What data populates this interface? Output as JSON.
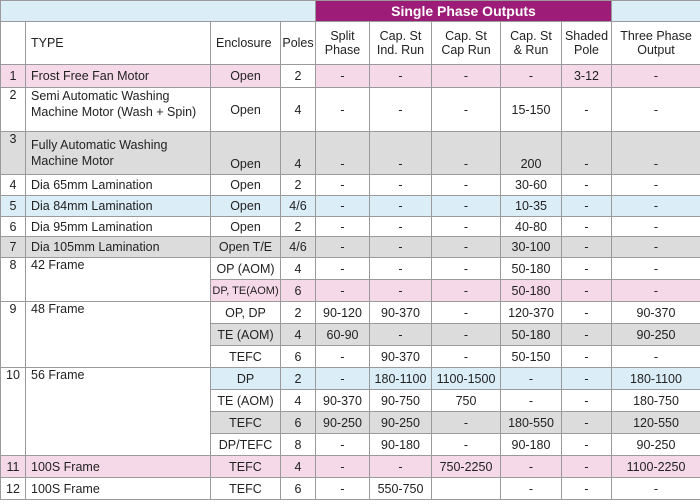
{
  "banner": "Single Phase Outputs",
  "headers": {
    "type": "TYPE",
    "enclosure": "Enclosure",
    "poles": "Poles",
    "split_phase": [
      "Split",
      "Phase"
    ],
    "cap_st_ind": [
      "Cap. St",
      "Ind. Run"
    ],
    "cap_st_cap": [
      "Cap. St",
      "Cap Run"
    ],
    "cap_st_run": [
      "Cap. St",
      "& Run"
    ],
    "shaded": [
      "Shaded",
      "Pole"
    ],
    "three_phase": [
      "Three Phase",
      "Output"
    ]
  },
  "rows": [
    {
      "no": "1",
      "type": "Frost Free Fan Motor",
      "enc": "Open",
      "poles": "2",
      "split": "-",
      "ind": "-",
      "cap": "-",
      "run": "-",
      "shaded": "3-12",
      "three": "-"
    },
    {
      "no": "2",
      "type": "Semi Automatic Washing",
      "type2": "Machine Motor (Wash + Spin)",
      "enc": "Open",
      "poles": "4",
      "split": "-",
      "ind": "-",
      "cap": "-",
      "run": "15-150",
      "shaded": "-",
      "three": "-"
    },
    {
      "no": "3",
      "type": "Fully Automatic Washing",
      "type2": "Machine Motor",
      "enc": "Open",
      "poles": "4",
      "split": "-",
      "ind": "-",
      "cap": "-",
      "run": "200",
      "shaded": "-",
      "three": "-"
    },
    {
      "no": "4",
      "type": "Dia 65mm Lamination",
      "enc": "Open",
      "poles": "2",
      "split": "-",
      "ind": "-",
      "cap": "-",
      "run": "30-60",
      "shaded": "-",
      "three": "-"
    },
    {
      "no": "5",
      "type": "Dia 84mm Lamination",
      "enc": "Open",
      "poles": "4/6",
      "split": "-",
      "ind": "-",
      "cap": "-",
      "run": "10-35",
      "shaded": "-",
      "three": "-"
    },
    {
      "no": "6",
      "type": "Dia 95mm Lamination",
      "enc": "Open",
      "poles": "2",
      "split": "-",
      "ind": "-",
      "cap": "-",
      "run": "40-80",
      "shaded": "-",
      "three": "-"
    },
    {
      "no": "7",
      "type": "Dia 105mm Lamination",
      "enc": "Open T/E",
      "poles": "4/6",
      "split": "-",
      "ind": "-",
      "cap": "-",
      "run": "30-100",
      "shaded": "-",
      "three": "-"
    },
    {
      "no": "8",
      "type": "42 Frame",
      "sub": [
        {
          "enc": "OP (AOM)",
          "poles": "4",
          "split": "-",
          "ind": "-",
          "cap": "-",
          "run": "50-180",
          "shaded": "-",
          "three": "-"
        },
        {
          "enc": "DP, TE(AOM)",
          "poles": "6",
          "split": "-",
          "ind": "-",
          "cap": "-",
          "run": "50-180",
          "shaded": "-",
          "three": "-"
        }
      ]
    },
    {
      "no": "9",
      "type": "48 Frame",
      "sub": [
        {
          "enc": "OP, DP",
          "poles": "2",
          "split": "90-120",
          "ind": "90-370",
          "cap": "-",
          "run": "120-370",
          "shaded": "-",
          "three": "90-370"
        },
        {
          "enc": "TE (AOM)",
          "poles": "4",
          "split": "60-90",
          "ind": "-",
          "cap": "-",
          "run": "50-180",
          "shaded": "-",
          "three": "90-250"
        },
        {
          "enc": "TEFC",
          "poles": "6",
          "split": "-",
          "ind": "90-370",
          "cap": "-",
          "run": "50-150",
          "shaded": "-",
          "three": "-"
        }
      ]
    },
    {
      "no": "10",
      "type": "56 Frame",
      "sub": [
        {
          "enc": "DP",
          "poles": "2",
          "split": "-",
          "ind": "180-1100",
          "cap": "1100-1500",
          "run": "-",
          "shaded": "-",
          "three": "180-1100"
        },
        {
          "enc": "TE (AOM)",
          "poles": "4",
          "split": "90-370",
          "ind": "90-750",
          "cap": "750",
          "run": "-",
          "shaded": "-",
          "three": "180-750"
        },
        {
          "enc": "TEFC",
          "poles": "6",
          "split": "90-250",
          "ind": "90-250",
          "cap": "-",
          "run": "180-550",
          "shaded": "-",
          "three": "120-550"
        },
        {
          "enc": "DP/TEFC",
          "poles": "8",
          "split": "-",
          "ind": "90-180",
          "cap": "-",
          "run": "90-180",
          "shaded": "-",
          "three": "90-250"
        }
      ]
    },
    {
      "no": "11",
      "type": "100S Frame",
      "enc": "TEFC",
      "poles": "4",
      "split": "-",
      "ind": "-",
      "cap": "750-2250",
      "run": "-",
      "shaded": "-",
      "three": "1100-2250"
    },
    {
      "no": "12",
      "type": "100S Frame",
      "enc": "TEFC",
      "poles": "6",
      "split": "-",
      "ind": "550-750",
      "cap": "",
      "run": "-",
      "shaded": "-",
      "three": "-"
    }
  ]
}
